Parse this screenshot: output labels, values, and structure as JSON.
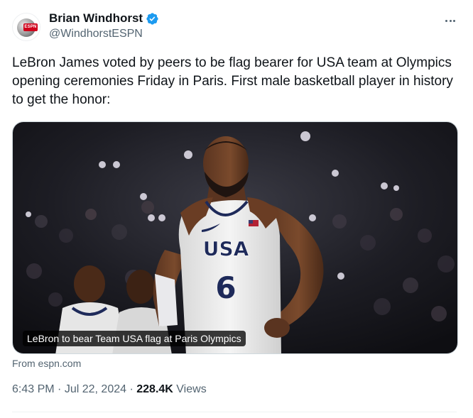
{
  "author": {
    "display_name": "Brian Windhorst",
    "handle": "@WindhorstESPN",
    "avatar_badge": "ESPN",
    "verified": true,
    "verified_color": "#1d9bf0"
  },
  "tweet": {
    "text": "LeBron James voted by peers to be flag bearer for USA team at Olympics opening ceremonies Friday in Paris. First male basketball player in history to get the honor:"
  },
  "media": {
    "caption": "LeBron to bear Team USA flag at Paris Olympics",
    "jersey_text": "USA",
    "jersey_number": "6",
    "source": "From espn.com"
  },
  "meta": {
    "time": "6:43 PM",
    "separator": "·",
    "date": "Jul 22, 2024",
    "views_count": "228.4K",
    "views_label": "Views"
  },
  "icons": {
    "more": "more-icon",
    "verified": "verified-badge-icon"
  }
}
